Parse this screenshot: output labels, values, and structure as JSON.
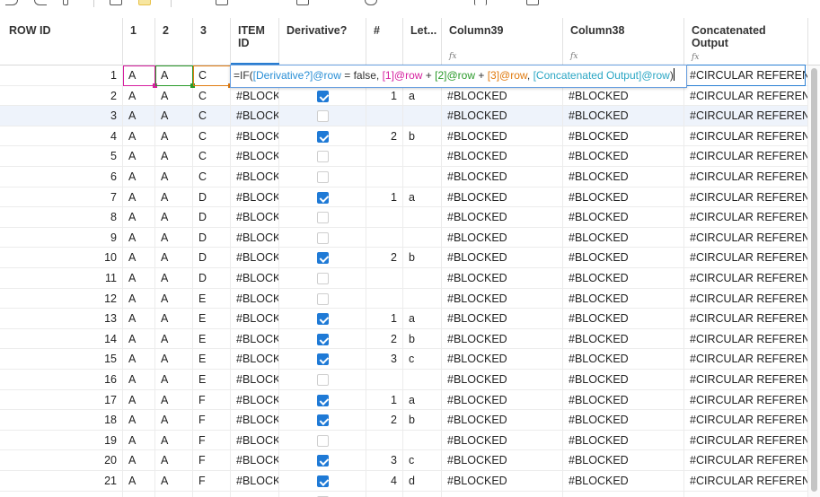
{
  "columns": {
    "row_id": "ROW ID",
    "c1": "1",
    "c2": "2",
    "c3": "3",
    "item_id": "ITEM ID",
    "derivative": "Derivative?",
    "hash": "#",
    "letter": "Let...",
    "col39": "Column39",
    "col38": "Column38",
    "concat": "Concatenated Output"
  },
  "formula": {
    "prefix": "=IF(",
    "ref_derivative": "[Derivative?]@row",
    "t1": " = false, ",
    "ref_1": "[1]@row",
    "t2": " + ",
    "ref_2": "[2]@row",
    "t3": " + ",
    "ref_3": "[3]@row",
    "t4": ", ",
    "ref_concat": "[Concatenated Output]@row",
    "suffix": ")"
  },
  "colors": {
    "accent": "#2a7fd4",
    "checkbox_on": "#1f7ad6",
    "ref_pink": "#d61f9f",
    "ref_green": "#2a9a2a",
    "ref_orange": "#e07b10",
    "ref_teal": "#2aa6c4"
  },
  "rows": [
    {
      "id": "1",
      "c1": "A",
      "c2": "A",
      "c3": "C",
      "item": "",
      "der": null,
      "num": "",
      "let": "",
      "c39": "",
      "c38": "",
      "out": "#CIRCULAR REFERENCE"
    },
    {
      "id": "2",
      "c1": "A",
      "c2": "A",
      "c3": "C",
      "item": "#BLOCKED",
      "der": true,
      "num": "1",
      "let": "a",
      "c39": "#BLOCKED",
      "c38": "#BLOCKED",
      "out": "#CIRCULAR REFERENCE"
    },
    {
      "id": "3",
      "c1": "A",
      "c2": "A",
      "c3": "C",
      "item": "#BLOCKED",
      "der": false,
      "num": "",
      "let": "",
      "c39": "#BLOCKED",
      "c38": "#BLOCKED",
      "out": "#CIRCULAR REFERENCE"
    },
    {
      "id": "4",
      "c1": "A",
      "c2": "A",
      "c3": "C",
      "item": "#BLOCKED",
      "der": true,
      "num": "2",
      "let": "b",
      "c39": "#BLOCKED",
      "c38": "#BLOCKED",
      "out": "#CIRCULAR REFERENCE"
    },
    {
      "id": "5",
      "c1": "A",
      "c2": "A",
      "c3": "C",
      "item": "#BLOCKED",
      "der": false,
      "num": "",
      "let": "",
      "c39": "#BLOCKED",
      "c38": "#BLOCKED",
      "out": "#CIRCULAR REFERENCE"
    },
    {
      "id": "6",
      "c1": "A",
      "c2": "A",
      "c3": "C",
      "item": "#BLOCKED",
      "der": false,
      "num": "",
      "let": "",
      "c39": "#BLOCKED",
      "c38": "#BLOCKED",
      "out": "#CIRCULAR REFERENCE"
    },
    {
      "id": "7",
      "c1": "A",
      "c2": "A",
      "c3": "D",
      "item": "#BLOCKED",
      "der": true,
      "num": "1",
      "let": "a",
      "c39": "#BLOCKED",
      "c38": "#BLOCKED",
      "out": "#CIRCULAR REFERENCE"
    },
    {
      "id": "8",
      "c1": "A",
      "c2": "A",
      "c3": "D",
      "item": "#BLOCKED",
      "der": false,
      "num": "",
      "let": "",
      "c39": "#BLOCKED",
      "c38": "#BLOCKED",
      "out": "#CIRCULAR REFERENCE"
    },
    {
      "id": "9",
      "c1": "A",
      "c2": "A",
      "c3": "D",
      "item": "#BLOCKED",
      "der": false,
      "num": "",
      "let": "",
      "c39": "#BLOCKED",
      "c38": "#BLOCKED",
      "out": "#CIRCULAR REFERENCE"
    },
    {
      "id": "10",
      "c1": "A",
      "c2": "A",
      "c3": "D",
      "item": "#BLOCKED",
      "der": true,
      "num": "2",
      "let": "b",
      "c39": "#BLOCKED",
      "c38": "#BLOCKED",
      "out": "#CIRCULAR REFERENCE"
    },
    {
      "id": "11",
      "c1": "A",
      "c2": "A",
      "c3": "D",
      "item": "#BLOCKED",
      "der": false,
      "num": "",
      "let": "",
      "c39": "#BLOCKED",
      "c38": "#BLOCKED",
      "out": "#CIRCULAR REFERENCE"
    },
    {
      "id": "12",
      "c1": "A",
      "c2": "A",
      "c3": "E",
      "item": "#BLOCKED",
      "der": false,
      "num": "",
      "let": "",
      "c39": "#BLOCKED",
      "c38": "#BLOCKED",
      "out": "#CIRCULAR REFERENCE"
    },
    {
      "id": "13",
      "c1": "A",
      "c2": "A",
      "c3": "E",
      "item": "#BLOCKED",
      "der": true,
      "num": "1",
      "let": "a",
      "c39": "#BLOCKED",
      "c38": "#BLOCKED",
      "out": "#CIRCULAR REFERENCE"
    },
    {
      "id": "14",
      "c1": "A",
      "c2": "A",
      "c3": "E",
      "item": "#BLOCKED",
      "der": true,
      "num": "2",
      "let": "b",
      "c39": "#BLOCKED",
      "c38": "#BLOCKED",
      "out": "#CIRCULAR REFERENCE"
    },
    {
      "id": "15",
      "c1": "A",
      "c2": "A",
      "c3": "E",
      "item": "#BLOCKED",
      "der": true,
      "num": "3",
      "let": "c",
      "c39": "#BLOCKED",
      "c38": "#BLOCKED",
      "out": "#CIRCULAR REFERENCE"
    },
    {
      "id": "16",
      "c1": "A",
      "c2": "A",
      "c3": "E",
      "item": "#BLOCKED",
      "der": false,
      "num": "",
      "let": "",
      "c39": "#BLOCKED",
      "c38": "#BLOCKED",
      "out": "#CIRCULAR REFERENCE"
    },
    {
      "id": "17",
      "c1": "A",
      "c2": "A",
      "c3": "F",
      "item": "#BLOCKED",
      "der": true,
      "num": "1",
      "let": "a",
      "c39": "#BLOCKED",
      "c38": "#BLOCKED",
      "out": "#CIRCULAR REFERENCE"
    },
    {
      "id": "18",
      "c1": "A",
      "c2": "A",
      "c3": "F",
      "item": "#BLOCKED",
      "der": true,
      "num": "2",
      "let": "b",
      "c39": "#BLOCKED",
      "c38": "#BLOCKED",
      "out": "#CIRCULAR REFERENCE"
    },
    {
      "id": "19",
      "c1": "A",
      "c2": "A",
      "c3": "F",
      "item": "#BLOCKED",
      "der": false,
      "num": "",
      "let": "",
      "c39": "#BLOCKED",
      "c38": "#BLOCKED",
      "out": "#CIRCULAR REFERENCE"
    },
    {
      "id": "20",
      "c1": "A",
      "c2": "A",
      "c3": "F",
      "item": "#BLOCKED",
      "der": true,
      "num": "3",
      "let": "c",
      "c39": "#BLOCKED",
      "c38": "#BLOCKED",
      "out": "#CIRCULAR REFERENCE"
    },
    {
      "id": "21",
      "c1": "A",
      "c2": "A",
      "c3": "F",
      "item": "#BLOCKED",
      "der": true,
      "num": "4",
      "let": "d",
      "c39": "#BLOCKED",
      "c38": "#BLOCKED",
      "out": "#CIRCULAR REFERENCE"
    },
    {
      "id": "",
      "c1": "",
      "c2": "",
      "c3": "",
      "item": "#BLOCKED",
      "der": false,
      "num": "",
      "let": "",
      "c39": "#BLOCKED",
      "c38": "#BLOCKED",
      "out": "#CIRCULAR REFERENCE"
    }
  ]
}
